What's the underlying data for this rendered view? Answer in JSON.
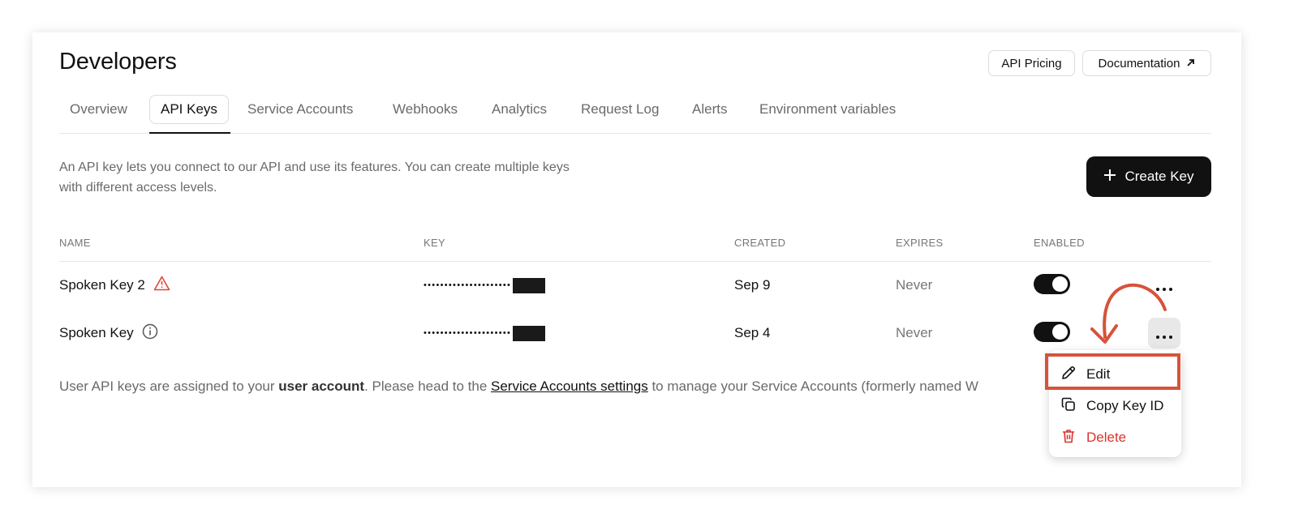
{
  "header": {
    "title": "Developers",
    "buttons": {
      "pricing": "API Pricing",
      "documentation": "Documentation"
    }
  },
  "tabs": [
    {
      "label": "Overview",
      "active": false
    },
    {
      "label": "API Keys",
      "active": true
    },
    {
      "label": "Service Accounts",
      "active": false
    },
    {
      "label": "Webhooks",
      "active": false
    },
    {
      "label": "Analytics",
      "active": false
    },
    {
      "label": "Request Log",
      "active": false
    },
    {
      "label": "Alerts",
      "active": false
    },
    {
      "label": "Environment variables",
      "active": false
    }
  ],
  "description": {
    "line1": "An API key lets you connect to our API and use its features. You can create multiple keys",
    "line2": "with different access levels."
  },
  "create_button": {
    "label": "Create Key",
    "icon": "plus-icon"
  },
  "table": {
    "columns": [
      "NAME",
      "KEY",
      "CREATED",
      "EXPIRES",
      "ENABLED"
    ],
    "rows": [
      {
        "name": "Spoken Key 2",
        "status_icon": "warning-icon",
        "key_mask": "•••••••••••••••••••••",
        "created": "Sep 9",
        "expires": "Never",
        "enabled": true
      },
      {
        "name": "Spoken Key",
        "status_icon": "info-icon",
        "key_mask": "•••••••••••••••••••••",
        "created": "Sep 4",
        "expires": "Never",
        "enabled": true
      }
    ]
  },
  "footnote": {
    "prefix": "User API keys are assigned to your ",
    "bold": "user account",
    "middle": ". Please head to the ",
    "link": "Service Accounts settings",
    "suffix": " to manage your Service Accounts (formerly named W"
  },
  "context_menu": {
    "items": [
      {
        "label": "Edit",
        "icon": "pencil-icon",
        "highlighted": true
      },
      {
        "label": "Copy Key ID",
        "icon": "copy-icon"
      },
      {
        "label": "Delete",
        "icon": "trash-icon",
        "danger": true
      }
    ]
  },
  "colors": {
    "accent": "#111111",
    "danger": "#d7342b",
    "annotation": "#d6533a",
    "warning": "#e0443a"
  }
}
